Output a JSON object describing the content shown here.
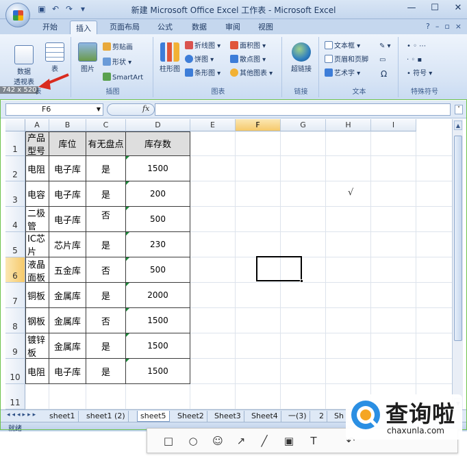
{
  "window": {
    "title": "新建 Microsoft Office Excel 工作表 - Microsoft Excel",
    "controls": [
      "—",
      "☐",
      "✕"
    ]
  },
  "ribbon": {
    "tabs": [
      "开始",
      "插入",
      "页面布局",
      "公式",
      "数据",
      "审阅",
      "视图"
    ],
    "active_tab": "插入",
    "groups": {
      "tables": {
        "label": "表",
        "pivot": "数据\n透视表",
        "table": "表"
      },
      "illustrations": {
        "label": "插图",
        "picture": "图片",
        "clipart": "剪贴画",
        "shapes": "形状",
        "smartart": "SmartArt"
      },
      "charts": {
        "label": "图表",
        "column": "柱形图",
        "line": "折线图",
        "pie": "饼图",
        "bar": "条形图",
        "area": "面积图",
        "scatter": "散点图",
        "other": "其他图表"
      },
      "links": {
        "label": "链接",
        "hyperlink": "超链接"
      },
      "text": {
        "label": "文本",
        "textbox": "文本框",
        "header_footer": "页眉和页脚",
        "wordart": "艺术字",
        "signature": "Ω"
      },
      "symbols": {
        "label": "特殊符号",
        "symbol": "符号"
      }
    }
  },
  "size_readout": "742 x 520",
  "formula_bar": {
    "name_box": "F6",
    "fx": "fx",
    "value": ""
  },
  "grid": {
    "columns": [
      "A",
      "B",
      "C",
      "D",
      "E",
      "F",
      "G",
      "H",
      "I"
    ],
    "selected_column": "F",
    "rows": [
      "1",
      "2",
      "3",
      "4",
      "5",
      "6",
      "7",
      "8",
      "9",
      "10",
      "11"
    ],
    "selected_row": "6",
    "active_cell": "F6",
    "header": [
      "产品型号",
      "库位",
      "有无盘点",
      "库存数"
    ],
    "data": [
      [
        "电阻",
        "电子库",
        "是",
        "1500"
      ],
      [
        "电容",
        "电子库",
        "是",
        "200"
      ],
      [
        "二极管",
        "电子库",
        "否",
        "500"
      ],
      [
        "IC芯片",
        "芯片库",
        "是",
        "230"
      ],
      [
        "液晶面板",
        "五金库",
        "否",
        "500"
      ],
      [
        "铜板",
        "金属库",
        "是",
        "2000"
      ],
      [
        "钢板",
        "金属库",
        "否",
        "1500"
      ],
      [
        "镀锌板",
        "金属库",
        "是",
        "1500"
      ],
      [
        "电阻",
        "电子库",
        "是",
        "1500"
      ]
    ],
    "stray_mark": "√"
  },
  "sheets": {
    "tabs": [
      "sheet1",
      "sheet1 (2)",
      "sheet5",
      "Sheet2",
      "Sheet3",
      "Sheet4",
      "一(3)",
      "2",
      "Sh"
    ],
    "active": "sheet5"
  },
  "status": {
    "text": "就绪"
  },
  "watermark": {
    "title": "查询啦",
    "url": "chaxunla.com"
  }
}
